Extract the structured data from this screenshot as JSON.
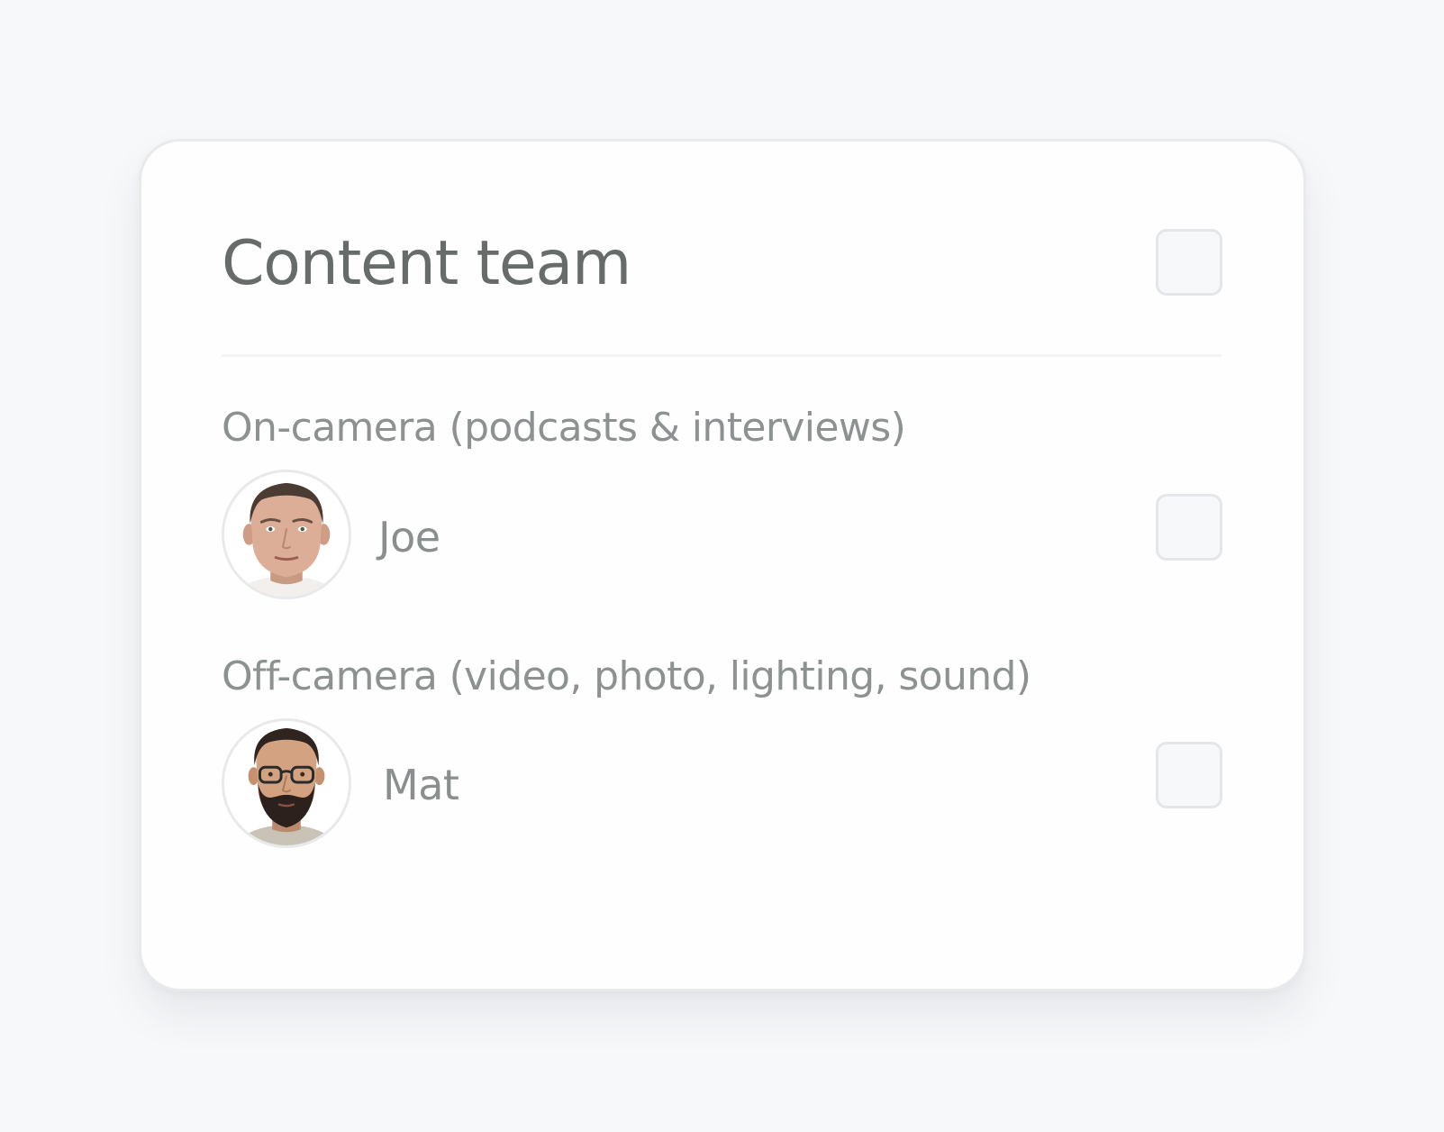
{
  "card": {
    "title": "Content team",
    "select_all_checked": false
  },
  "groups": [
    {
      "label": "On-camera (podcasts & interviews)",
      "members": [
        {
          "name": "Joe",
          "avatar_icon": "person-photo-avatar",
          "checked": false
        }
      ]
    },
    {
      "label": "Off-camera (video, photo, lighting, sound)",
      "members": [
        {
          "name": "Mat",
          "avatar_icon": "person-photo-avatar",
          "checked": false
        }
      ]
    }
  ],
  "colors": {
    "page_background": "#f7f8fa",
    "card_background": "#fefefe",
    "title_text": "#676b6a",
    "secondary_text": "#8d9191",
    "checkbox_border": "#e5e6e9"
  }
}
